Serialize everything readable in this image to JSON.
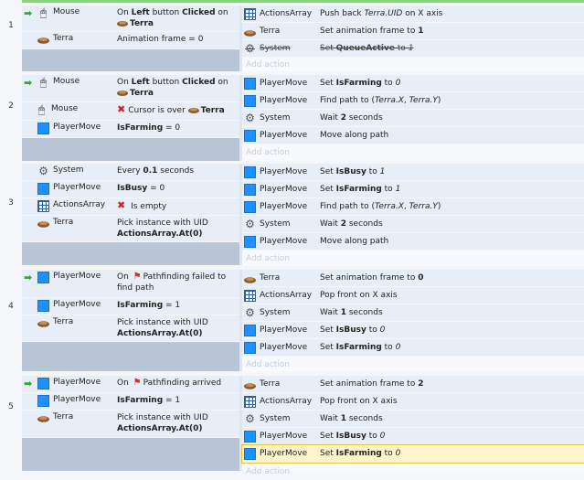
{
  "sheet": {
    "add_action_label": "Add action",
    "events": [
      {
        "number": "1",
        "conditions": [
          {
            "icon": "mouse-icon",
            "object": "Mouse",
            "trigger": true,
            "text_parts": [
              "On ",
              "Left",
              " button ",
              "Clicked",
              " on"
            ],
            "extra_line": "Terra"
          },
          {
            "icon": "terra-icon",
            "object": "Terra",
            "trigger": false,
            "text": "Animation frame = 0"
          }
        ],
        "actions": [
          {
            "icon": "grid-icon",
            "object": "ActionsArray",
            "text_parts": [
              "Push back ",
              "Terra.UID",
              "  on X axis"
            ]
          },
          {
            "icon": "terra-icon",
            "object": "Terra",
            "text_parts": [
              "Set animation frame to ",
              "1"
            ]
          },
          {
            "icon": "gear-icon",
            "object": "System",
            "disabled": true,
            "text_parts": [
              "Set ",
              "QueueActive",
              " to ",
              "1"
            ]
          }
        ]
      },
      {
        "number": "2",
        "conditions": [
          {
            "icon": "mouse-icon",
            "object": "Mouse",
            "trigger": true,
            "text_parts": [
              "On ",
              "Left",
              " button ",
              "Clicked",
              " on"
            ],
            "extra_line": "Terra"
          },
          {
            "icon": "mouse-icon",
            "object": "Mouse",
            "trigger": false,
            "text_parts": [
              "Cursor is over",
              "Terra"
            ]
          },
          {
            "icon": "blue-square-icon",
            "object": "PlayerMove",
            "trigger": false,
            "text_parts": [
              "IsFarming",
              " = 0"
            ]
          }
        ],
        "actions": [
          {
            "icon": "blue-square-icon",
            "object": "PlayerMove",
            "text_parts": [
              "Set ",
              "IsFarming",
              " to ",
              "0"
            ]
          },
          {
            "icon": "blue-square-icon",
            "object": "PlayerMove",
            "text_parts": [
              "Find path to (",
              "Terra.X",
              ", ",
              "Terra.Y",
              ")"
            ]
          },
          {
            "icon": "gear-icon",
            "object": "System",
            "text_parts": [
              "Wait ",
              "2",
              " seconds"
            ]
          },
          {
            "icon": "blue-square-icon",
            "object": "PlayerMove",
            "text": "Move along path"
          }
        ]
      },
      {
        "number": "3",
        "conditions": [
          {
            "icon": "gear-icon",
            "object": "System",
            "text_parts": [
              "Every ",
              "0.1",
              " seconds"
            ]
          },
          {
            "icon": "blue-square-icon",
            "object": "PlayerMove",
            "text_parts": [
              "IsBusy",
              " = 0"
            ]
          },
          {
            "icon": "grid-icon",
            "object": "ActionsArray",
            "text": "Is empty"
          },
          {
            "icon": "terra-icon",
            "object": "Terra",
            "text": "Pick instance with UID",
            "extra_line": "ActionsArray.At(0)"
          }
        ],
        "actions": [
          {
            "icon": "blue-square-icon",
            "object": "PlayerMove",
            "text_parts": [
              "Set ",
              "IsBusy",
              " to ",
              "1"
            ]
          },
          {
            "icon": "blue-square-icon",
            "object": "PlayerMove",
            "text_parts": [
              "Set ",
              "IsFarming",
              " to ",
              "1"
            ]
          },
          {
            "icon": "blue-square-icon",
            "object": "PlayerMove",
            "text_parts": [
              "Find path to (",
              "Terra.X",
              ", ",
              "Terra.Y",
              ")"
            ]
          },
          {
            "icon": "gear-icon",
            "object": "System",
            "text_parts": [
              "Wait ",
              "2",
              " seconds"
            ]
          },
          {
            "icon": "blue-square-icon",
            "object": "PlayerMove",
            "text": "Move along path"
          }
        ]
      },
      {
        "number": "4",
        "conditions": [
          {
            "icon": "blue-square-icon",
            "object": "PlayerMove",
            "trigger": true,
            "text_parts": [
              "On",
              "Pathfinding failed to"
            ],
            "extra_line": "find path"
          },
          {
            "icon": "blue-square-icon",
            "object": "PlayerMove",
            "text_parts": [
              "IsFarming",
              " = 1"
            ]
          },
          {
            "icon": "terra-icon",
            "object": "Terra",
            "text": "Pick instance with UID",
            "extra_line": "ActionsArray.At(0)"
          }
        ],
        "actions": [
          {
            "icon": "terra-icon",
            "object": "Terra",
            "text_parts": [
              "Set animation frame to ",
              "0"
            ]
          },
          {
            "icon": "grid-icon",
            "object": "ActionsArray",
            "text": "Pop front on X axis"
          },
          {
            "icon": "gear-icon",
            "object": "System",
            "text_parts": [
              "Wait ",
              "1",
              " seconds"
            ]
          },
          {
            "icon": "blue-square-icon",
            "object": "PlayerMove",
            "text_parts": [
              "Set ",
              "IsBusy",
              " to ",
              "0"
            ]
          },
          {
            "icon": "blue-square-icon",
            "object": "PlayerMove",
            "text_parts": [
              "Set ",
              "IsFarming",
              " to ",
              "0"
            ]
          }
        ]
      },
      {
        "number": "5",
        "conditions": [
          {
            "icon": "blue-square-icon",
            "object": "PlayerMove",
            "trigger": true,
            "text_parts": [
              "On",
              "Pathfinding arrived"
            ]
          },
          {
            "icon": "blue-square-icon",
            "object": "PlayerMove",
            "text_parts": [
              "IsFarming",
              " = 1"
            ]
          },
          {
            "icon": "terra-icon",
            "object": "Terra",
            "text": "Pick instance with UID",
            "extra_line": "ActionsArray.At(0)"
          }
        ],
        "actions": [
          {
            "icon": "terra-icon",
            "object": "Terra",
            "text_parts": [
              "Set animation frame to ",
              "2"
            ]
          },
          {
            "icon": "grid-icon",
            "object": "ActionsArray",
            "text": "Pop front on X axis"
          },
          {
            "icon": "gear-icon",
            "object": "System",
            "text_parts": [
              "Wait ",
              "1",
              " seconds"
            ]
          },
          {
            "icon": "blue-square-icon",
            "object": "PlayerMove",
            "text_parts": [
              "Set ",
              "IsBusy",
              " to ",
              "0"
            ]
          },
          {
            "icon": "blue-square-icon",
            "object": "PlayerMove",
            "highlighted": true,
            "text_parts": [
              "Set ",
              "IsFarming",
              " to ",
              "0"
            ]
          }
        ]
      }
    ]
  },
  "colors": {
    "row_bg": "#e7eef7",
    "block_bg": "#b9c6d8",
    "trigger_arrow": "#3aa53a",
    "invert_x": "#d0202a",
    "highlight": "#fff5cc"
  }
}
